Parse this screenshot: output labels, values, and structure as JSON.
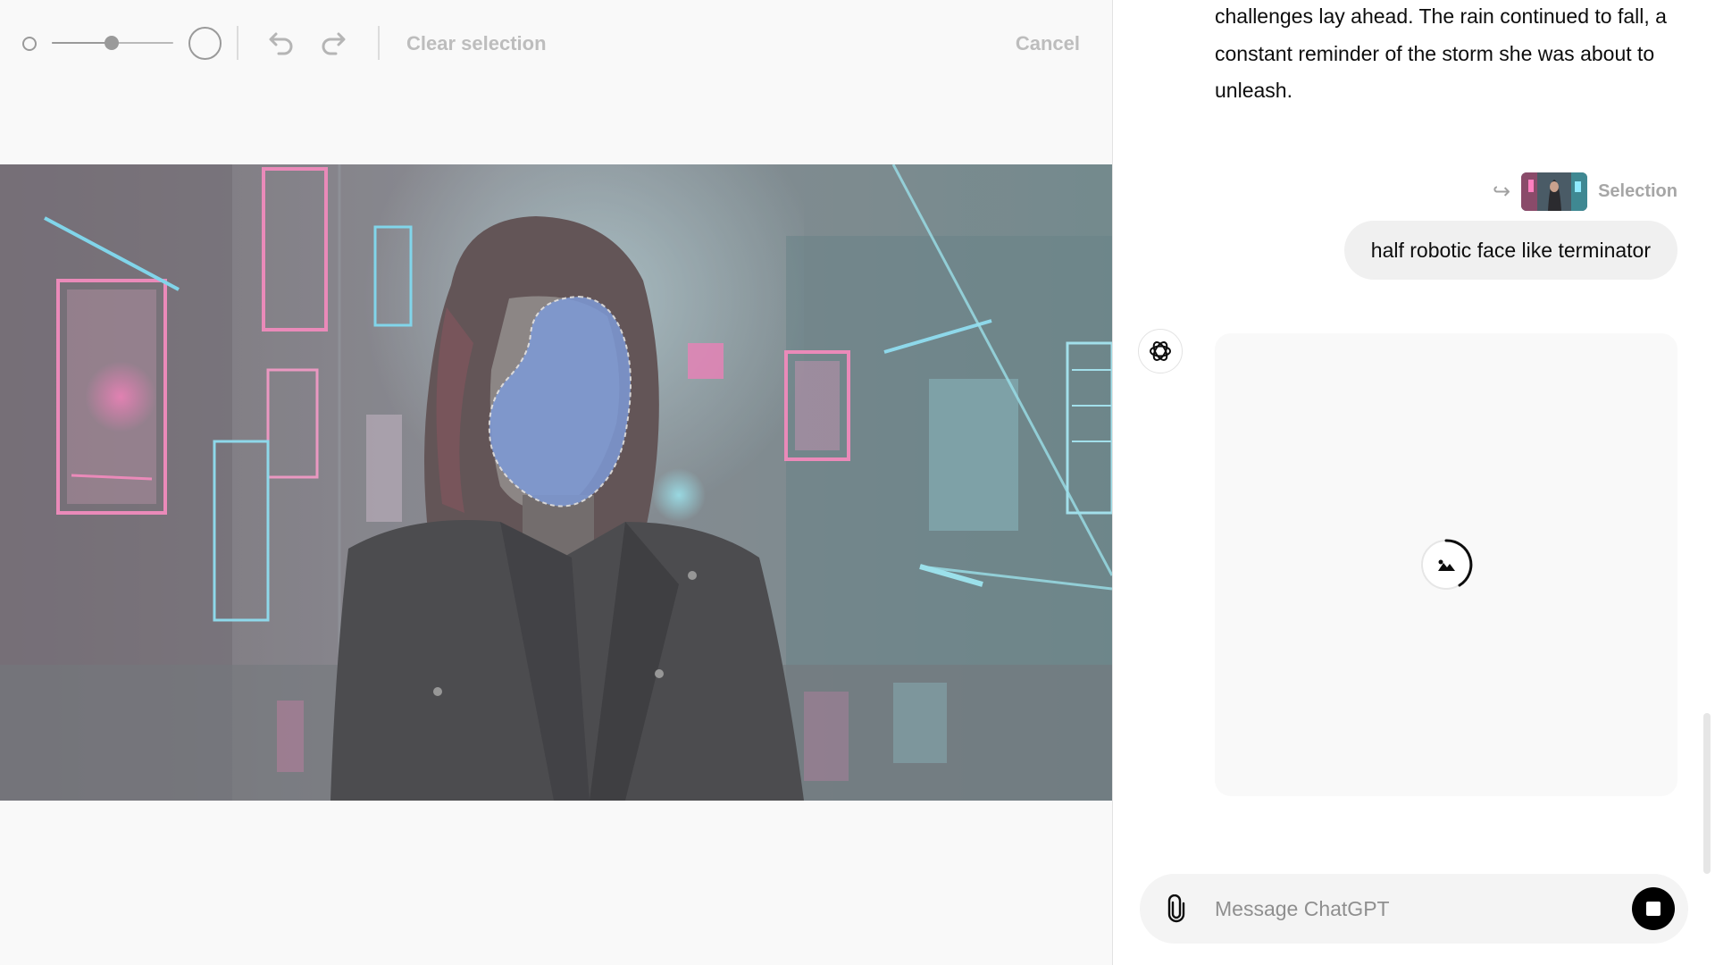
{
  "toolbar": {
    "brush_size_percent": 50,
    "clear_selection_label": "Clear selection",
    "cancel_label": "Cancel"
  },
  "chat": {
    "previous_message": "challenges lay ahead. The rain continued to fall, a constant reminder of the storm she was about to unleash.",
    "selection_label": "Selection",
    "user_message": "half robotic face like terminator",
    "assistant_status": "generating-image",
    "composer": {
      "placeholder": "Message ChatGPT"
    }
  },
  "icons": {
    "undo": "undo-icon",
    "redo": "redo-icon",
    "attach": "paperclip-icon",
    "assistant": "openai-logo-icon",
    "stop": "stop-icon",
    "selection_arrow": "reply-arrow-icon",
    "generating": "image-spinner-icon"
  },
  "colors": {
    "mask_overlay": "#7b9ee8",
    "neon_pink": "#ff4fa3",
    "neon_cyan": "#5fe9ff",
    "stop_button": "#000000"
  }
}
